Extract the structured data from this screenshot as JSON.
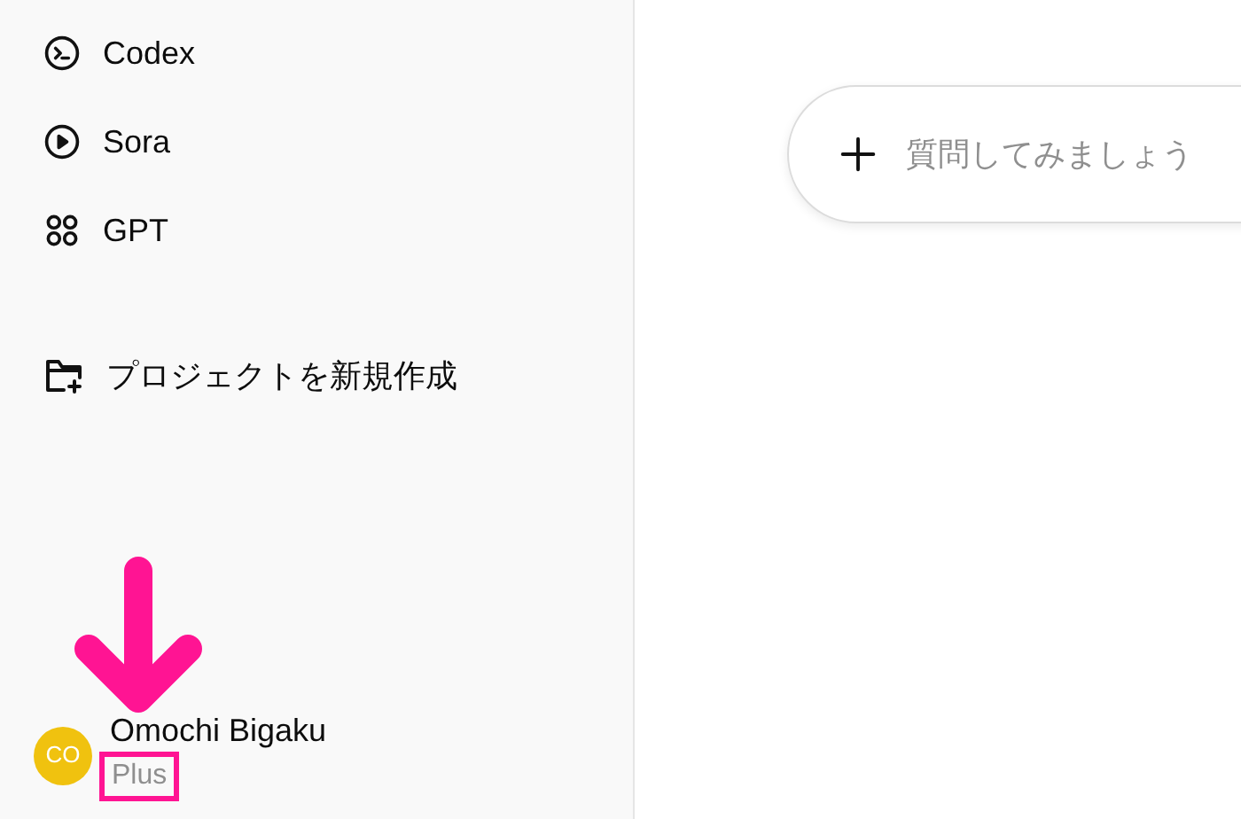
{
  "sidebar": {
    "items": [
      {
        "kind": "codex",
        "label": "Codex"
      },
      {
        "kind": "sora",
        "label": "Sora"
      },
      {
        "kind": "gpt",
        "label": "GPT"
      }
    ],
    "new_project": {
      "label": "プロジェクトを新規作成"
    },
    "user": {
      "initials": "CO",
      "name": "Omochi Bigaku",
      "plan": "Plus",
      "plan_highlighted": true
    }
  },
  "composer": {
    "placeholder": "質問してみましょう"
  }
}
